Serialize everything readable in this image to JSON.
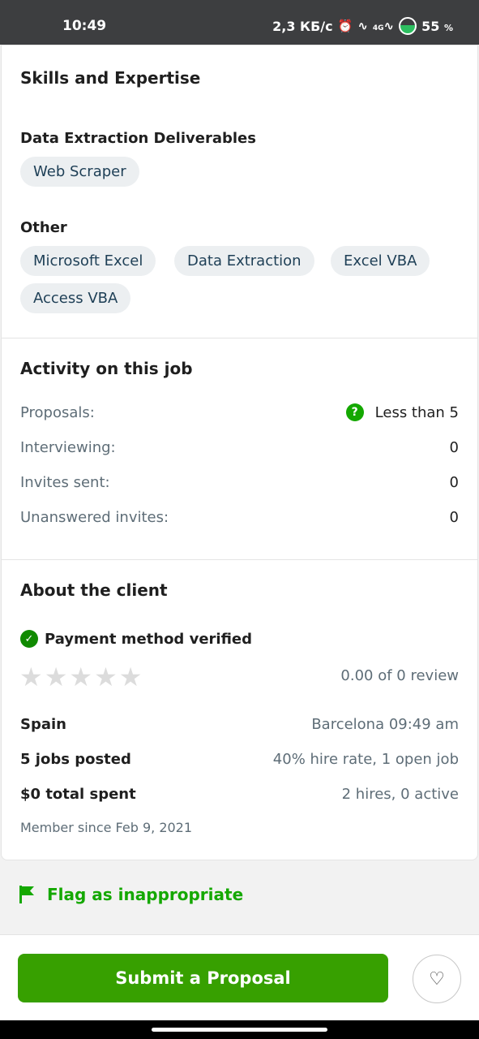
{
  "status_bar": {
    "time": "10:49",
    "speed": "2,3 КБ/с",
    "alarm_icon": "alarm-icon",
    "network": "4G",
    "battery_percent": "55",
    "battery_unit": "%"
  },
  "skills": {
    "title": "Skills and Expertise",
    "group1": {
      "title": "Data Extraction Deliverables",
      "chips": [
        "Web Scraper"
      ]
    },
    "group2": {
      "title": "Other",
      "chips": [
        "Microsoft Excel",
        "Data Extraction",
        "Excel VBA",
        "Access VBA"
      ]
    }
  },
  "activity": {
    "title": "Activity on this job",
    "help_icon": "?",
    "rows": [
      {
        "label": "Proposals:",
        "value": "Less than 5"
      },
      {
        "label": "Interviewing:",
        "value": "0"
      },
      {
        "label": "Invites sent:",
        "value": "0"
      },
      {
        "label": "Unanswered invites:",
        "value": "0"
      }
    ]
  },
  "client": {
    "title": "About the client",
    "payment": "Payment method verified",
    "check_icon": "✓",
    "rating_stars": 0,
    "star_glyph": "★",
    "review": "0.00 of 0 review",
    "rows": [
      {
        "label": "Spain",
        "value": "Barcelona 09:49 am"
      },
      {
        "label": "5 jobs posted",
        "value": "40% hire rate, 1 open job"
      },
      {
        "label": "$0 total spent",
        "value": "2 hires, 0 active"
      }
    ],
    "member_since": "Member since Feb 9, 2021"
  },
  "flag_label": "Flag as inappropriate",
  "submit_label": "Submit a Proposal",
  "heart_glyph": "♡",
  "colors": {
    "accent_green": "#14a800",
    "button_green": "#37a000",
    "chip_bg": "#eceff1"
  }
}
